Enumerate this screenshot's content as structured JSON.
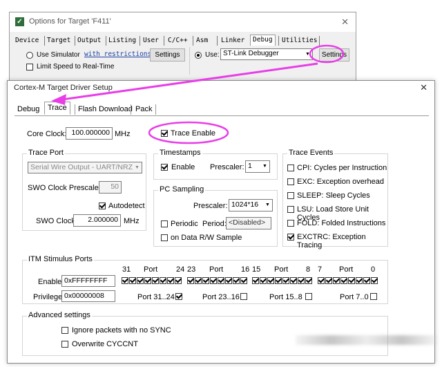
{
  "options_window": {
    "title": "Options for Target 'F411'",
    "close": "✕",
    "tabs": [
      "Device",
      "Target",
      "Output",
      "Listing",
      "User",
      "C/C++",
      "Asm",
      "Linker",
      "Debug",
      "Utilities"
    ],
    "active_tab": "Debug",
    "use_simulator": "Use Simulator",
    "with_restrictions": "with restrictions",
    "settings_left": "Settings",
    "limit_speed": "Limit Speed to Real-Time",
    "use": "Use:",
    "debugger": "ST-Link Debugger",
    "settings_right": "Settings"
  },
  "driver_window": {
    "title": "Cortex-M Target Driver Setup",
    "close": "✕",
    "tabs": [
      "Debug",
      "Trace",
      "Flash Download",
      "Pack"
    ],
    "active_tab": "Trace",
    "core_clock_label": "Core Clock:",
    "core_clock_value": "100.000000",
    "core_clock_unit": "MHz",
    "trace_enable": "Trace Enable",
    "trace_port": {
      "title": "Trace Port",
      "port_value": "Serial Wire Output - UART/NRZ",
      "swo_prescaler_label": "SWO Clock Prescaler:",
      "swo_prescaler_value": "50",
      "autodetect": "Autodetect",
      "swo_clock_label": "SWO Clock:",
      "swo_clock_value": "2.000000",
      "swo_clock_unit": "MHz"
    },
    "timestamps": {
      "title": "Timestamps",
      "enable": "Enable",
      "prescaler_label": "Prescaler:",
      "prescaler_value": "1"
    },
    "pc_sampling": {
      "title": "PC Sampling",
      "prescaler_label": "Prescaler:",
      "prescaler_value": "1024*16",
      "periodic": "Periodic",
      "period_label": "Period:",
      "period_value": "<Disabled>",
      "on_data": "on Data R/W Sample"
    },
    "trace_events": {
      "title": "Trace Events",
      "items": [
        {
          "label": "CPI: Cycles per Instruction",
          "checked": false
        },
        {
          "label": "EXC: Exception overhead",
          "checked": false
        },
        {
          "label": "SLEEP: Sleep Cycles",
          "checked": false
        },
        {
          "label": "LSU: Load Store Unit Cycles",
          "checked": false
        },
        {
          "label": "FOLD: Folded Instructions",
          "checked": false
        },
        {
          "label": "EXCTRC: Exception Tracing",
          "checked": true
        }
      ]
    },
    "itm": {
      "title": "ITM Stimulus Ports",
      "header": {
        "n31": "31",
        "port_a": "Port",
        "n24": "24",
        "n23": "23",
        "port_b": "Port",
        "n16": "16",
        "n15": "15",
        "port_c": "Port",
        "n8": "8",
        "n7": "7",
        "port_d": "Port",
        "n0": "0"
      },
      "enable_label": "Enable:",
      "enable_value": "0xFFFFFFFF",
      "privilege_label": "Privilege:",
      "privilege_value": "0x00000008",
      "port_groups": [
        {
          "label": "Port 31..24",
          "checked": true
        },
        {
          "label": "Port 23..16",
          "checked": false
        },
        {
          "label": "Port 15..8",
          "checked": false
        },
        {
          "label": "Port 7..0",
          "checked": false
        }
      ]
    },
    "advanced": {
      "title": "Advanced settings",
      "ignore_packets": "Ignore packets with no SYNC",
      "overwrite": "Overwrite CYCCNT"
    }
  },
  "colors": {
    "annotation": "#e83ee8",
    "title_text": "#222222",
    "link": "#1a3fa0"
  }
}
